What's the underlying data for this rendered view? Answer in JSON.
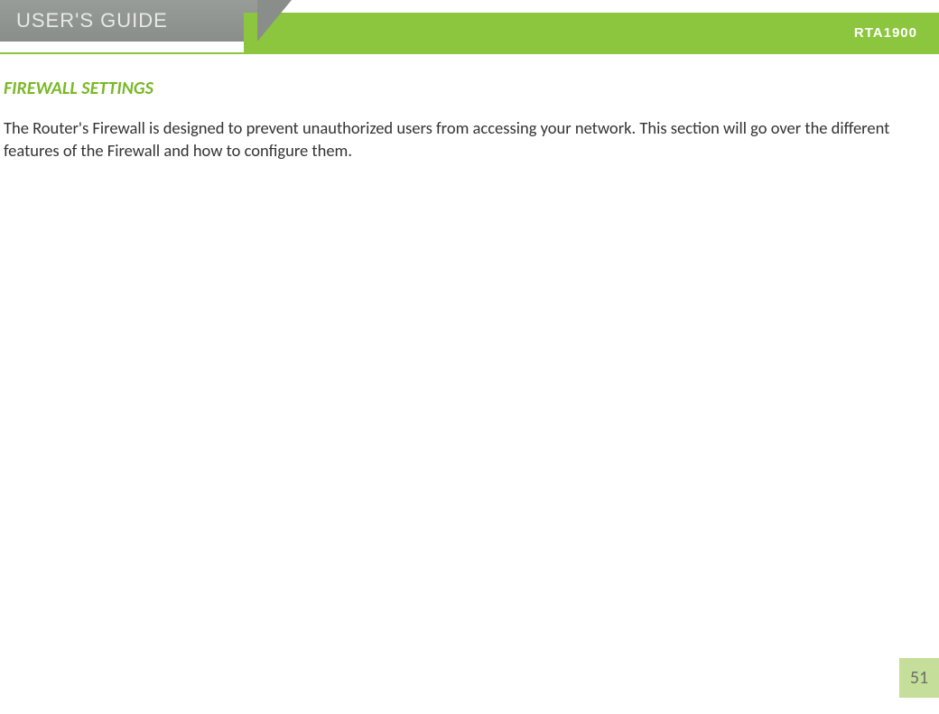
{
  "header": {
    "guide_label": "USER'S GUIDE",
    "model": "RTA1900"
  },
  "section": {
    "title": "FIREWALL SETTINGS",
    "body": "The Router's Firewall is designed to prevent unauthorized users from accessing your network. This section will go over the different features of the Firewall and how to configure them."
  },
  "page_number": "51"
}
